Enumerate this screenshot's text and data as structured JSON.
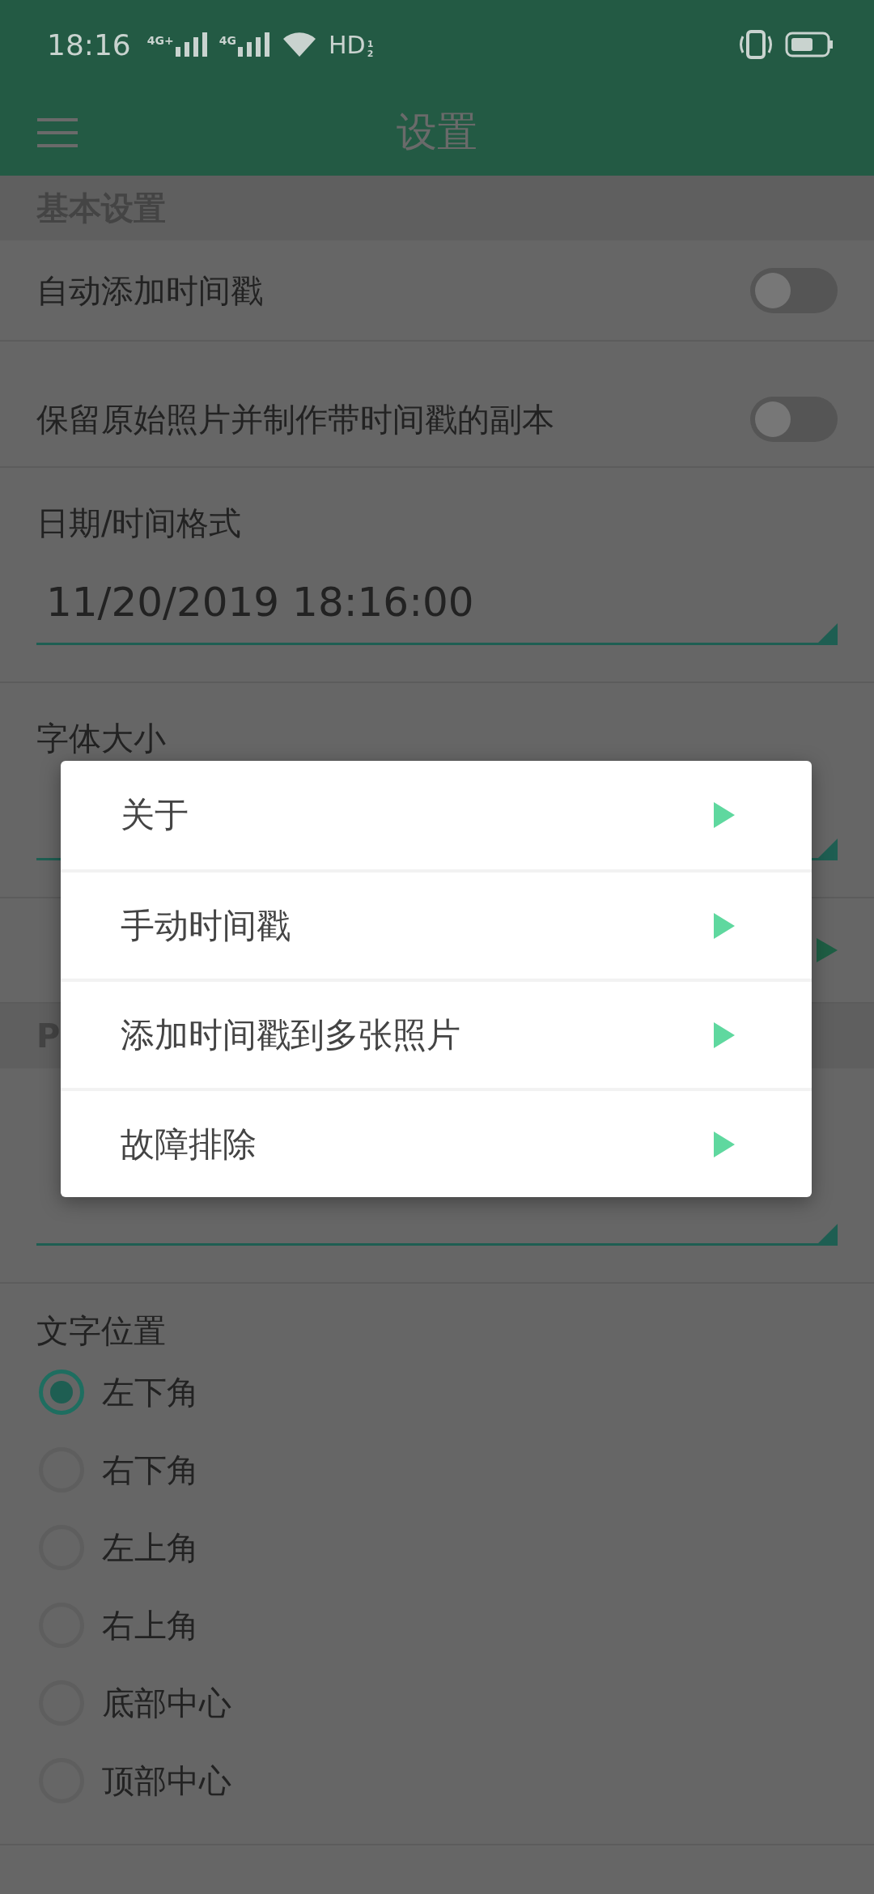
{
  "status_bar": {
    "time": "18:16",
    "signals": [
      {
        "label": "4G+"
      },
      {
        "label": "4G"
      }
    ],
    "hd": "HD",
    "hd_slots": [
      "1",
      "2"
    ]
  },
  "app_bar": {
    "title": "设置"
  },
  "sections": [
    {
      "header": "基本设置",
      "items": [
        {
          "kind": "switch",
          "label": "自动添加时间戳",
          "on": false
        },
        {
          "kind": "switch",
          "label": "保留原始照片并制作带时间戳的副本",
          "on": false
        },
        {
          "kind": "dropdown",
          "label": "日期/时间格式",
          "value": "11/20/2019 18:16:00"
        },
        {
          "kind": "dropdown",
          "label": "字体大小"
        },
        {
          "kind": "link"
        }
      ]
    },
    {
      "header": "P",
      "items": [
        {
          "kind": "dropdown"
        },
        {
          "kind": "radio",
          "label": "文字位置",
          "options": [
            {
              "label": "左下角",
              "selected": true
            },
            {
              "label": "右下角",
              "selected": false
            },
            {
              "label": "左上角",
              "selected": false
            },
            {
              "label": "右上角",
              "selected": false
            },
            {
              "label": "底部中心",
              "selected": false
            },
            {
              "label": "顶部中心",
              "selected": false
            }
          ]
        }
      ]
    }
  ],
  "dialog": {
    "items": [
      {
        "label": "关于"
      },
      {
        "label": "手动时间戳"
      },
      {
        "label": "添加时间戳到多张照片"
      },
      {
        "label": "故障排除"
      }
    ]
  }
}
